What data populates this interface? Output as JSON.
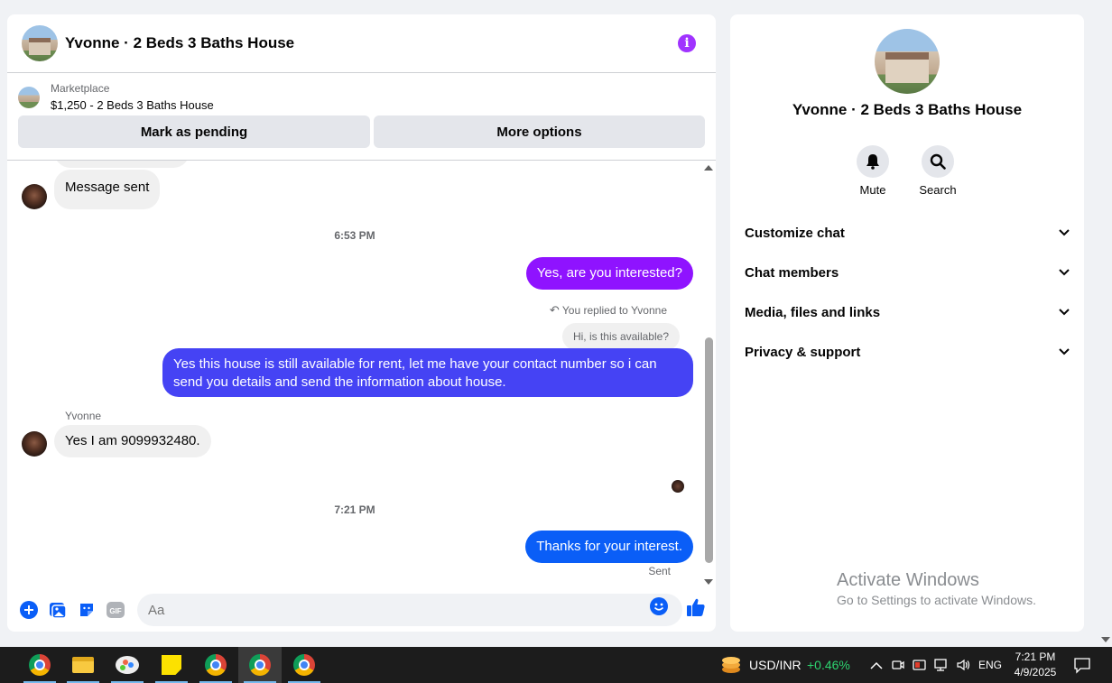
{
  "chat": {
    "title": "Yvonne · 2 Beds 3 Baths House",
    "marketplace_label": "Marketplace",
    "listing": "$1,250 - 2 Beds 3 Baths House",
    "mark_pending_label": "Mark as pending",
    "more_options_label": "More options",
    "messages": {
      "first": "Message sent",
      "time1": "6:53 PM",
      "out1": "Yes, are you interested?",
      "reply_note": "You replied to Yvonne",
      "reply_quote": "Hi, is this available?",
      "out2": "Yes this house is still available for rent, let me have your contact number so i can send you details and send the information about house.",
      "sender": "Yvonne",
      "in2": "Yes I am 9099932480.",
      "time2": "7:21 PM",
      "out3": "Thanks for your interest.",
      "status": "Sent"
    },
    "composer_placeholder": "Aa"
  },
  "info_panel": {
    "name": "Yvonne · 2 Beds 3 Baths House",
    "mute_label": "Mute",
    "search_label": "Search",
    "sections": [
      "Customize chat",
      "Chat members",
      "Media, files and links",
      "Privacy & support"
    ]
  },
  "watermark": {
    "title": "Activate Windows",
    "subtitle": "Go to Settings to activate Windows."
  },
  "taskbar": {
    "ticker": "USD/INR",
    "change": "+0.46%",
    "language": "ENG",
    "time": "7:21 PM",
    "date": "4/9/2025"
  },
  "colors": {
    "accent_purple": "#8f13ff",
    "accent_indigo": "#4543f4",
    "accent_blue": "#0a5ef7",
    "ticker_green": "#2dd36f"
  }
}
